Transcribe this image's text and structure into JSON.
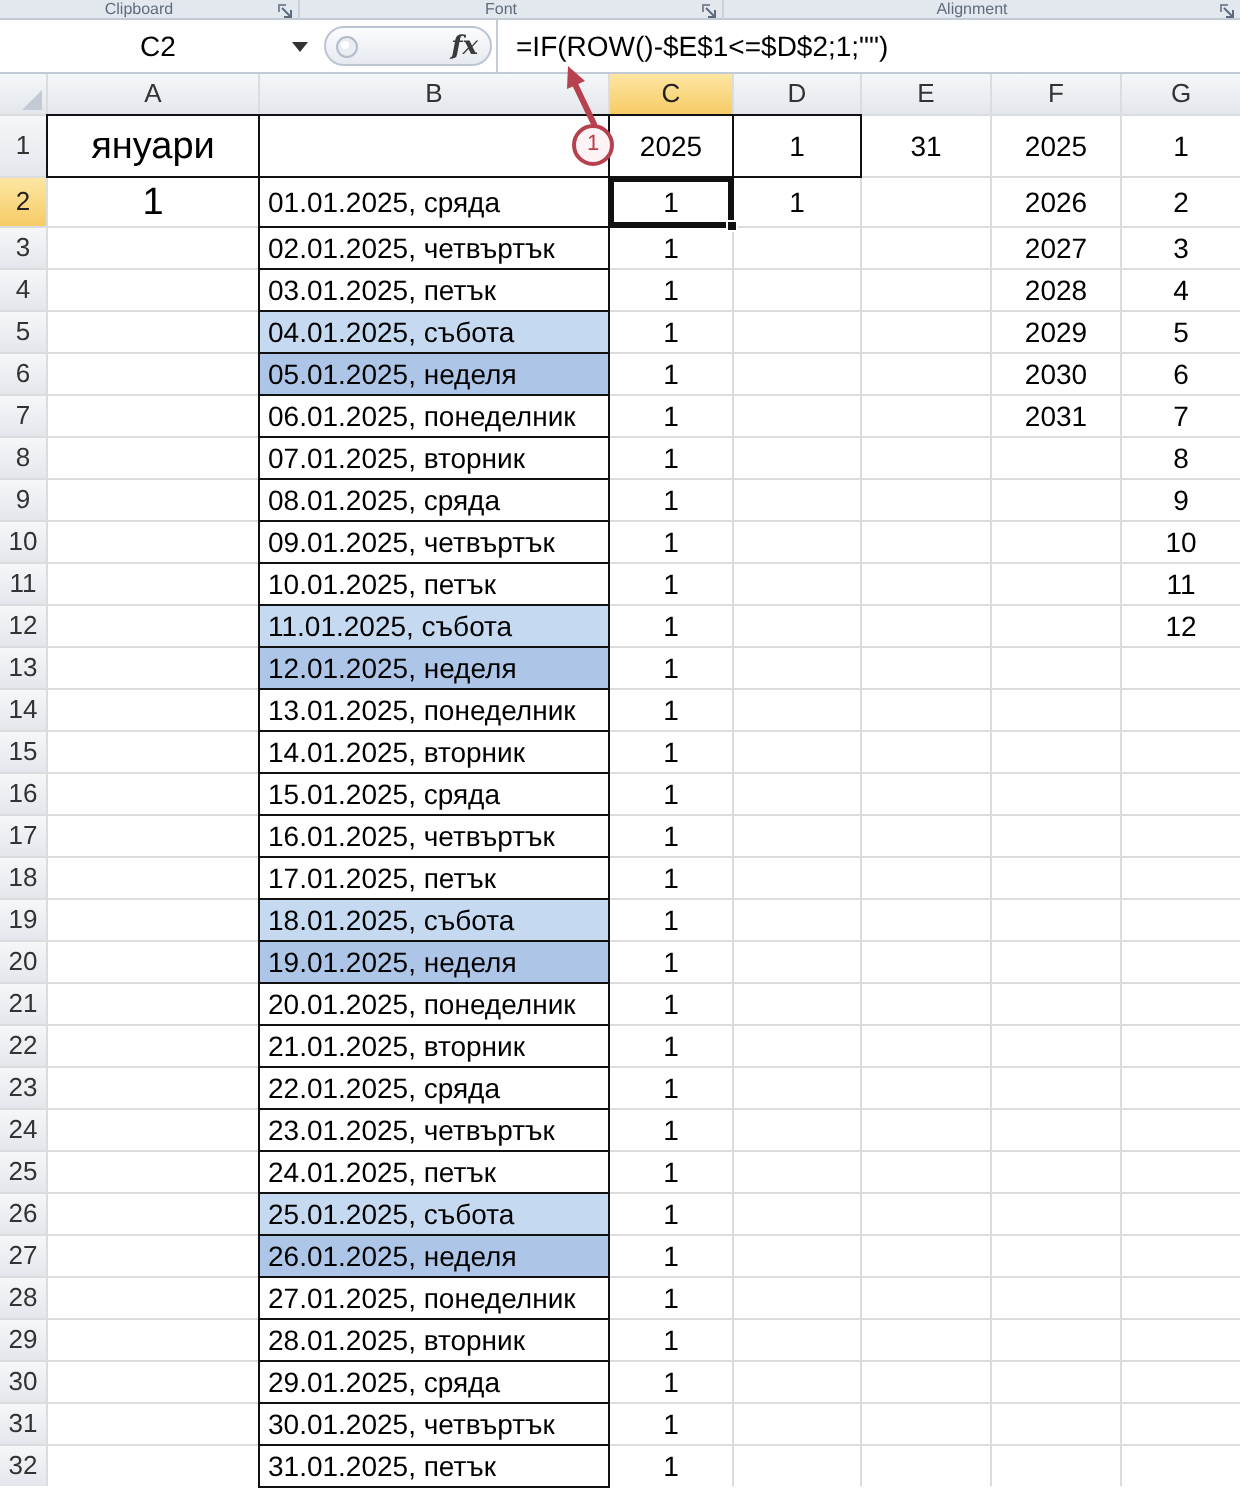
{
  "ribbon_groups": [
    {
      "label": "Clipboard"
    },
    {
      "label": "Font"
    },
    {
      "label": "Alignment"
    }
  ],
  "formula_bar": {
    "name_box": "C2",
    "function_button": "fx",
    "formula": "=IF(ROW()-$E$1<=$D$2;1;\"\")"
  },
  "columns": [
    {
      "label": "A",
      "selected": false
    },
    {
      "label": "B",
      "selected": false
    },
    {
      "label": "C",
      "selected": true
    },
    {
      "label": "D",
      "selected": false
    },
    {
      "label": "E",
      "selected": false
    },
    {
      "label": "F",
      "selected": false
    },
    {
      "label": "G",
      "selected": false
    }
  ],
  "rows": [
    {
      "label": "1",
      "selected": false,
      "cells": [
        {
          "text": "януари",
          "boxed": true,
          "selected": false
        },
        {
          "boxed": true,
          "selected": false
        },
        {
          "text": "2025",
          "boxed": true,
          "selected": false
        },
        {
          "text": "1",
          "boxed": true,
          "selected": false
        },
        {
          "text": "31",
          "selected": false
        },
        {
          "text": "2025",
          "selected": false
        },
        {
          "text": "1",
          "selected": false
        }
      ]
    },
    {
      "label": "2",
      "selected": true,
      "cells": [
        {
          "text": "1",
          "selected": false
        },
        {
          "text": "01.01.2025, сряда",
          "boxed": true,
          "selected": false
        },
        {
          "text": "1",
          "selected": true
        },
        {
          "text": "1",
          "selected": false
        },
        {
          "selected": false
        },
        {
          "text": "2026",
          "selected": false
        },
        {
          "text": "2",
          "selected": false
        }
      ]
    },
    {
      "label": "3",
      "selected": false,
      "cells": [
        {
          "selected": false
        },
        {
          "text": "02.01.2025, четвъртък",
          "boxed": true,
          "selected": false
        },
        {
          "text": "1",
          "selected": false
        },
        {
          "selected": false
        },
        {
          "selected": false
        },
        {
          "text": "2027",
          "selected": false
        },
        {
          "text": "3",
          "selected": false
        }
      ]
    },
    {
      "label": "4",
      "selected": false,
      "cells": [
        {
          "selected": false
        },
        {
          "text": "03.01.2025, петък",
          "boxed": true,
          "selected": false
        },
        {
          "text": "1",
          "selected": false
        },
        {
          "selected": false
        },
        {
          "selected": false
        },
        {
          "text": "2028",
          "selected": false
        },
        {
          "text": "4",
          "selected": false
        }
      ]
    },
    {
      "label": "5",
      "selected": false,
      "cells": [
        {
          "selected": false
        },
        {
          "text": "04.01.2025, събота",
          "boxed": true,
          "color": "#c5d9f1",
          "selected": false
        },
        {
          "text": "1",
          "selected": false
        },
        {
          "selected": false
        },
        {
          "selected": false
        },
        {
          "text": "2029",
          "selected": false
        },
        {
          "text": "5",
          "selected": false
        }
      ]
    },
    {
      "label": "6",
      "selected": false,
      "cells": [
        {
          "selected": false
        },
        {
          "text": "05.01.2025, неделя",
          "boxed": true,
          "color": "#adc6e8",
          "selected": false
        },
        {
          "text": "1",
          "selected": false
        },
        {
          "selected": false
        },
        {
          "selected": false
        },
        {
          "text": "2030",
          "selected": false
        },
        {
          "text": "6",
          "selected": false
        }
      ]
    },
    {
      "label": "7",
      "selected": false,
      "cells": [
        {
          "selected": false
        },
        {
          "text": "06.01.2025, понеделник",
          "boxed": true,
          "selected": false
        },
        {
          "text": "1",
          "selected": false
        },
        {
          "selected": false
        },
        {
          "selected": false
        },
        {
          "text": "2031",
          "selected": false
        },
        {
          "text": "7",
          "selected": false
        }
      ]
    },
    {
      "label": "8",
      "selected": false,
      "cells": [
        {
          "selected": false
        },
        {
          "text": "07.01.2025, вторник",
          "boxed": true,
          "selected": false
        },
        {
          "text": "1",
          "selected": false
        },
        {
          "selected": false
        },
        {
          "selected": false
        },
        {
          "selected": false
        },
        {
          "text": "8",
          "selected": false
        }
      ]
    },
    {
      "label": "9",
      "selected": false,
      "cells": [
        {
          "selected": false
        },
        {
          "text": "08.01.2025, сряда",
          "boxed": true,
          "selected": false
        },
        {
          "text": "1",
          "selected": false
        },
        {
          "selected": false
        },
        {
          "selected": false
        },
        {
          "selected": false
        },
        {
          "text": "9",
          "selected": false
        }
      ]
    },
    {
      "label": "10",
      "selected": false,
      "cells": [
        {
          "selected": false
        },
        {
          "text": "09.01.2025, четвъртък",
          "boxed": true,
          "selected": false
        },
        {
          "text": "1",
          "selected": false
        },
        {
          "selected": false
        },
        {
          "selected": false
        },
        {
          "selected": false
        },
        {
          "text": "10",
          "selected": false
        }
      ]
    },
    {
      "label": "11",
      "selected": false,
      "cells": [
        {
          "selected": false
        },
        {
          "text": "10.01.2025, петък",
          "boxed": true,
          "selected": false
        },
        {
          "text": "1",
          "selected": false
        },
        {
          "selected": false
        },
        {
          "selected": false
        },
        {
          "selected": false
        },
        {
          "text": "11",
          "selected": false
        }
      ]
    },
    {
      "label": "12",
      "selected": false,
      "cells": [
        {
          "selected": false
        },
        {
          "text": "11.01.2025, събота",
          "boxed": true,
          "color": "#c5d9f1",
          "selected": false
        },
        {
          "text": "1",
          "selected": false
        },
        {
          "selected": false
        },
        {
          "selected": false
        },
        {
          "selected": false
        },
        {
          "text": "12",
          "selected": false
        }
      ]
    },
    {
      "label": "13",
      "selected": false,
      "cells": [
        {
          "selected": false
        },
        {
          "text": "12.01.2025, неделя",
          "boxed": true,
          "color": "#adc6e8",
          "selected": false
        },
        {
          "text": "1",
          "selected": false
        },
        {
          "selected": false
        },
        {
          "selected": false
        },
        {
          "selected": false
        },
        {
          "selected": false
        }
      ]
    },
    {
      "label": "14",
      "selected": false,
      "cells": [
        {
          "selected": false
        },
        {
          "text": "13.01.2025, понеделник",
          "boxed": true,
          "selected": false
        },
        {
          "text": "1",
          "selected": false
        },
        {
          "selected": false
        },
        {
          "selected": false
        },
        {
          "selected": false
        },
        {
          "selected": false
        }
      ]
    },
    {
      "label": "15",
      "selected": false,
      "cells": [
        {
          "selected": false
        },
        {
          "text": "14.01.2025, вторник",
          "boxed": true,
          "selected": false
        },
        {
          "text": "1",
          "selected": false
        },
        {
          "selected": false
        },
        {
          "selected": false
        },
        {
          "selected": false
        },
        {
          "selected": false
        }
      ]
    },
    {
      "label": "16",
      "selected": false,
      "cells": [
        {
          "selected": false
        },
        {
          "text": "15.01.2025, сряда",
          "boxed": true,
          "selected": false
        },
        {
          "text": "1",
          "selected": false
        },
        {
          "selected": false
        },
        {
          "selected": false
        },
        {
          "selected": false
        },
        {
          "selected": false
        }
      ]
    },
    {
      "label": "17",
      "selected": false,
      "cells": [
        {
          "selected": false
        },
        {
          "text": "16.01.2025, четвъртък",
          "boxed": true,
          "selected": false
        },
        {
          "text": "1",
          "selected": false
        },
        {
          "selected": false
        },
        {
          "selected": false
        },
        {
          "selected": false
        },
        {
          "selected": false
        }
      ]
    },
    {
      "label": "18",
      "selected": false,
      "cells": [
        {
          "selected": false
        },
        {
          "text": "17.01.2025, петък",
          "boxed": true,
          "selected": false
        },
        {
          "text": "1",
          "selected": false
        },
        {
          "selected": false
        },
        {
          "selected": false
        },
        {
          "selected": false
        },
        {
          "selected": false
        }
      ]
    },
    {
      "label": "19",
      "selected": false,
      "cells": [
        {
          "selected": false
        },
        {
          "text": "18.01.2025, събота",
          "boxed": true,
          "color": "#c5d9f1",
          "selected": false
        },
        {
          "text": "1",
          "selected": false
        },
        {
          "selected": false
        },
        {
          "selected": false
        },
        {
          "selected": false
        },
        {
          "selected": false
        }
      ]
    },
    {
      "label": "20",
      "selected": false,
      "cells": [
        {
          "selected": false
        },
        {
          "text": "19.01.2025, неделя",
          "boxed": true,
          "color": "#adc6e8",
          "selected": false
        },
        {
          "text": "1",
          "selected": false
        },
        {
          "selected": false
        },
        {
          "selected": false
        },
        {
          "selected": false
        },
        {
          "selected": false
        }
      ]
    },
    {
      "label": "21",
      "selected": false,
      "cells": [
        {
          "selected": false
        },
        {
          "text": "20.01.2025, понеделник",
          "boxed": true,
          "selected": false
        },
        {
          "text": "1",
          "selected": false
        },
        {
          "selected": false
        },
        {
          "selected": false
        },
        {
          "selected": false
        },
        {
          "selected": false
        }
      ]
    },
    {
      "label": "22",
      "selected": false,
      "cells": [
        {
          "selected": false
        },
        {
          "text": "21.01.2025, вторник",
          "boxed": true,
          "selected": false
        },
        {
          "text": "1",
          "selected": false
        },
        {
          "selected": false
        },
        {
          "selected": false
        },
        {
          "selected": false
        },
        {
          "selected": false
        }
      ]
    },
    {
      "label": "23",
      "selected": false,
      "cells": [
        {
          "selected": false
        },
        {
          "text": "22.01.2025, сряда",
          "boxed": true,
          "selected": false
        },
        {
          "text": "1",
          "selected": false
        },
        {
          "selected": false
        },
        {
          "selected": false
        },
        {
          "selected": false
        },
        {
          "selected": false
        }
      ]
    },
    {
      "label": "24",
      "selected": false,
      "cells": [
        {
          "selected": false
        },
        {
          "text": "23.01.2025, четвъртък",
          "boxed": true,
          "selected": false
        },
        {
          "text": "1",
          "selected": false
        },
        {
          "selected": false
        },
        {
          "selected": false
        },
        {
          "selected": false
        },
        {
          "selected": false
        }
      ]
    },
    {
      "label": "25",
      "selected": false,
      "cells": [
        {
          "selected": false
        },
        {
          "text": "24.01.2025, петък",
          "boxed": true,
          "selected": false
        },
        {
          "text": "1",
          "selected": false
        },
        {
          "selected": false
        },
        {
          "selected": false
        },
        {
          "selected": false
        },
        {
          "selected": false
        }
      ]
    },
    {
      "label": "26",
      "selected": false,
      "cells": [
        {
          "selected": false
        },
        {
          "text": "25.01.2025, събота",
          "boxed": true,
          "color": "#c5d9f1",
          "selected": false
        },
        {
          "text": "1",
          "selected": false
        },
        {
          "selected": false
        },
        {
          "selected": false
        },
        {
          "selected": false
        },
        {
          "selected": false
        }
      ]
    },
    {
      "label": "27",
      "selected": false,
      "cells": [
        {
          "selected": false
        },
        {
          "text": "26.01.2025, неделя",
          "boxed": true,
          "color": "#adc6e8",
          "selected": false
        },
        {
          "text": "1",
          "selected": false
        },
        {
          "selected": false
        },
        {
          "selected": false
        },
        {
          "selected": false
        },
        {
          "selected": false
        }
      ]
    },
    {
      "label": "28",
      "selected": false,
      "cells": [
        {
          "selected": false
        },
        {
          "text": "27.01.2025, понеделник",
          "boxed": true,
          "selected": false
        },
        {
          "text": "1",
          "selected": false
        },
        {
          "selected": false
        },
        {
          "selected": false
        },
        {
          "selected": false
        },
        {
          "selected": false
        }
      ]
    },
    {
      "label": "29",
      "selected": false,
      "cells": [
        {
          "selected": false
        },
        {
          "text": "28.01.2025, вторник",
          "boxed": true,
          "selected": false
        },
        {
          "text": "1",
          "selected": false
        },
        {
          "selected": false
        },
        {
          "selected": false
        },
        {
          "selected": false
        },
        {
          "selected": false
        }
      ]
    },
    {
      "label": "30",
      "selected": false,
      "cells": [
        {
          "selected": false
        },
        {
          "text": "29.01.2025, сряда",
          "boxed": true,
          "selected": false
        },
        {
          "text": "1",
          "selected": false
        },
        {
          "selected": false
        },
        {
          "selected": false
        },
        {
          "selected": false
        },
        {
          "selected": false
        }
      ]
    },
    {
      "label": "31",
      "selected": false,
      "cells": [
        {
          "selected": false
        },
        {
          "text": "30.01.2025, четвъртък",
          "boxed": true,
          "selected": false
        },
        {
          "text": "1",
          "selected": false
        },
        {
          "selected": false
        },
        {
          "selected": false
        },
        {
          "selected": false
        },
        {
          "selected": false
        }
      ]
    },
    {
      "label": "32",
      "selected": false,
      "cells": [
        {
          "selected": false
        },
        {
          "text": "31.01.2025, петък",
          "boxed": true,
          "selected": false
        },
        {
          "text": "1",
          "selected": false
        },
        {
          "selected": false
        },
        {
          "selected": false
        },
        {
          "selected": false
        },
        {
          "selected": false
        }
      ]
    }
  ],
  "annotation": {
    "label": "1"
  }
}
